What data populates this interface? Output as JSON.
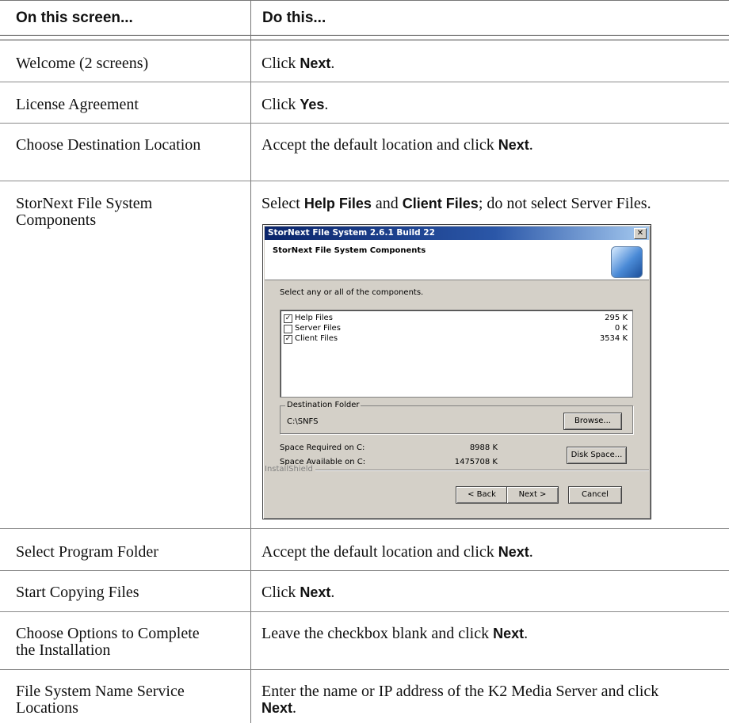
{
  "table": {
    "header": {
      "col1": "On this screen...",
      "col2": "Do this..."
    },
    "rows": [
      {
        "screen": "Welcome (2 screens)",
        "pre": "Click ",
        "kw": "Next",
        "post": "."
      },
      {
        "screen": "License Agreement",
        "pre": "Click ",
        "kw": "Yes",
        "post": "."
      },
      {
        "screen": "Choose Destination Location",
        "pre": "Accept the default location and click ",
        "kw": "Next",
        "post": "."
      },
      {
        "screen": "StorNext File System Components",
        "pre": "Select ",
        "kw": "Help Files",
        "mid": " and ",
        "kw2": "Client Files",
        "post": "; do not select Server Files."
      },
      {
        "screen": "Select Program Folder",
        "pre": "Accept the default location and click ",
        "kw": "Next",
        "post": "."
      },
      {
        "screen": "Start Copying Files",
        "pre": "Click ",
        "kw": "Next",
        "post": "."
      },
      {
        "screen": "Choose Options to Complete the Installation",
        "pre": "Leave the checkbox blank and click ",
        "kw": "Next",
        "post": "."
      },
      {
        "screen": "File System Name Service Locations",
        "pre": "Enter the name or IP address of the K2 Media Server and click ",
        "kw": "Next",
        "post": "."
      }
    ]
  },
  "dialog": {
    "title": "StorNext File System 2.6.1 Build 22",
    "close_glyph": "✕",
    "header_title": "StorNext File System Components",
    "instruction": "Select any or all of the components.",
    "components": [
      {
        "name": "Help Files",
        "size": "295 K",
        "checked": true,
        "check": "✓"
      },
      {
        "name": "Server Files",
        "size": "0 K",
        "checked": false,
        "check": ""
      },
      {
        "name": "Client Files",
        "size": "3534 K",
        "checked": true,
        "check": "✓"
      }
    ],
    "destination_label": "Destination Folder",
    "destination_path": "C:\\SNFS",
    "browse_label": "Browse...",
    "space_required_label": "Space Required on C:",
    "space_required_value": "8988 K",
    "space_available_label": "Space Available on C:",
    "space_available_value": "1475708 K",
    "disk_space_label": "Disk Space...",
    "installshield_label": "InstallShield",
    "back_label": "< Back",
    "next_label": "Next >",
    "cancel_label": "Cancel"
  }
}
